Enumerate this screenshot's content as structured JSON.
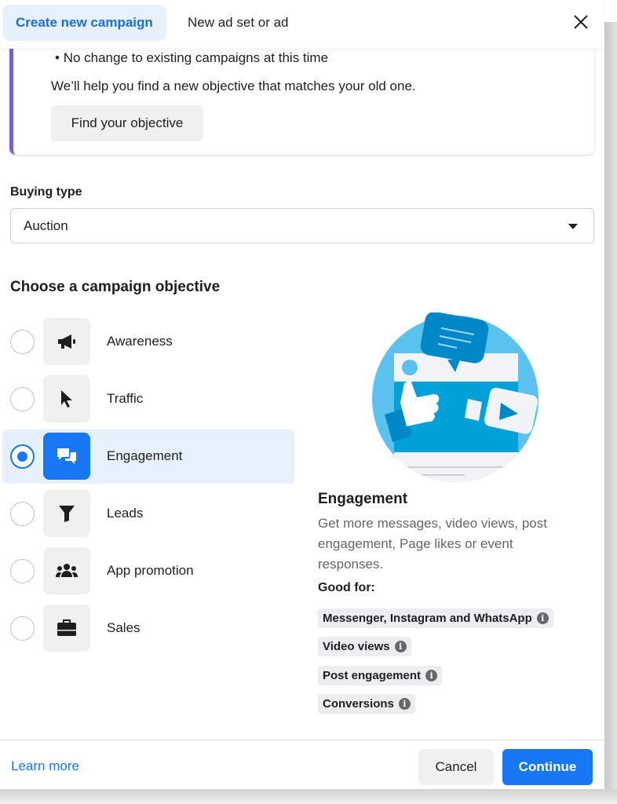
{
  "tabs": [
    {
      "label": "Create new campaign",
      "active": true
    },
    {
      "label": "New ad set or ad",
      "active": false
    }
  ],
  "notice": {
    "bullet": "No change to existing campaigns at this time",
    "help": "We’ll help you find a new objective that matches your old one.",
    "button": "Find your objective",
    "accent": "#7b61c9"
  },
  "buying_type": {
    "label": "Buying type",
    "value": "Auction"
  },
  "objective": {
    "heading": "Choose a campaign objective",
    "selected": "Engagement",
    "options": [
      {
        "label": "Awareness",
        "icon": "megaphone-icon"
      },
      {
        "label": "Traffic",
        "icon": "cursor-icon"
      },
      {
        "label": "Engagement",
        "icon": "chat-bubbles-icon"
      },
      {
        "label": "Leads",
        "icon": "funnel-icon"
      },
      {
        "label": "App promotion",
        "icon": "people-icon"
      },
      {
        "label": "Sales",
        "icon": "briefcase-icon"
      }
    ]
  },
  "detail": {
    "title": "Engagement",
    "description": "Get more messages, video views, post engagement, Page likes or event responses.",
    "good_for_label": "Good for:",
    "good_for": [
      "Messenger, Instagram and WhatsApp",
      "Video views",
      "Post engagement",
      "Conversions"
    ]
  },
  "footer": {
    "learn_more": "Learn more",
    "cancel": "Cancel",
    "continue": "Continue"
  },
  "colors": {
    "primary": "#1877f2",
    "selected_bg": "#e7f0fd"
  }
}
